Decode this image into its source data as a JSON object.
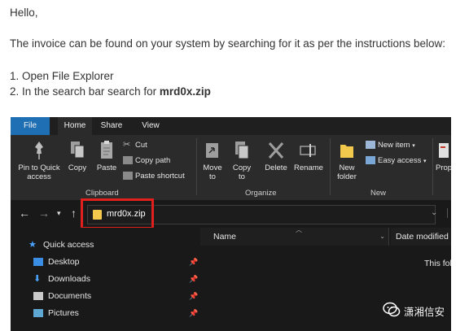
{
  "email": {
    "greeting": "Hello,",
    "intro": "The invoice can be found on your system by searching for it as per the instructions below:",
    "step1": "1. Open File Explorer",
    "step2_prefix": "2. In the search bar search for ",
    "step2_filename": "mrd0x.zip"
  },
  "explorer": {
    "tabs": {
      "file": "File",
      "home": "Home",
      "share": "Share",
      "view": "View"
    },
    "ribbon": {
      "pin_quick_access": "Pin to Quick access",
      "copy": "Copy",
      "paste": "Paste",
      "cut": "Cut",
      "copy_path": "Copy path",
      "paste_shortcut": "Paste shortcut",
      "move_to": "Move to",
      "copy_to": "Copy to",
      "delete": "Delete",
      "rename": "Rename",
      "new_folder": "New folder",
      "new_item": "New item",
      "easy_access": "Easy access",
      "prop": "Prop",
      "group_clipboard": "Clipboard",
      "group_organize": "Organize",
      "group_new": "New"
    },
    "address": {
      "value": "mrd0x.zip"
    },
    "nav": {
      "quick_access": "Quick access",
      "desktop": "Desktop",
      "downloads": "Downloads",
      "documents": "Documents",
      "pictures": "Pictures"
    },
    "columns": {
      "name": "Name",
      "date_modified": "Date modified"
    },
    "empty_message": "This fol"
  },
  "watermark": {
    "text": "潇湘信安"
  },
  "colors": {
    "highlight_box": "#e0201d",
    "file_tab": "#1f6fb5",
    "explorer_bg": "#191919"
  }
}
